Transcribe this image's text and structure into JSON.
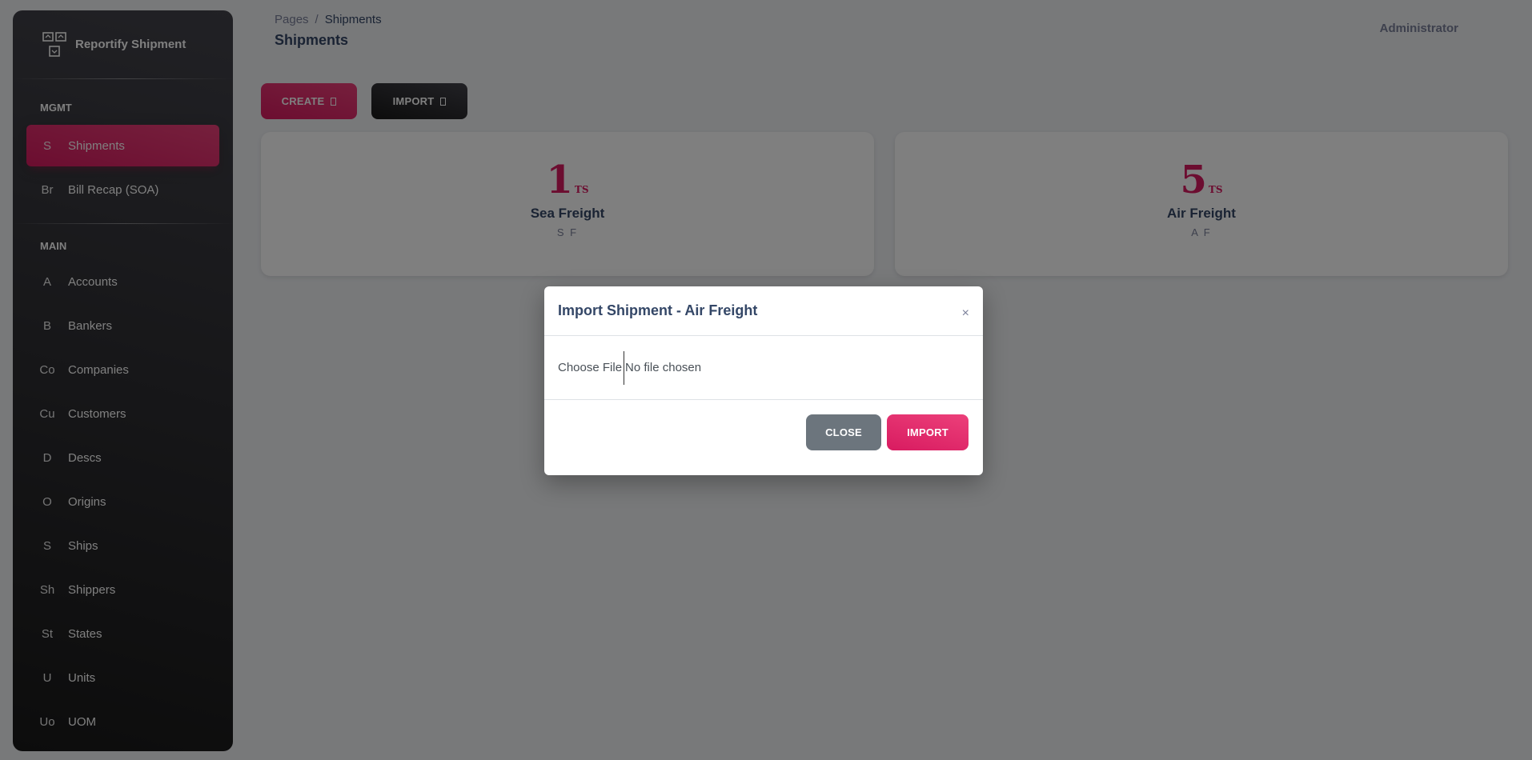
{
  "brand": {
    "name": "Reportify Shipment",
    "logo_icon": "boxes-logo-icon"
  },
  "sidebar": {
    "sections": [
      {
        "title": "MGMT",
        "items": [
          {
            "abbr": "S",
            "label": "Shipments",
            "active": true
          },
          {
            "abbr": "Br",
            "label": "Bill Recap (SOA)",
            "active": false
          }
        ]
      },
      {
        "title": "MAIN",
        "items": [
          {
            "abbr": "A",
            "label": "Accounts"
          },
          {
            "abbr": "B",
            "label": "Bankers"
          },
          {
            "abbr": "Co",
            "label": "Companies"
          },
          {
            "abbr": "Cu",
            "label": "Customers"
          },
          {
            "abbr": "D",
            "label": "Descs"
          },
          {
            "abbr": "O",
            "label": "Origins"
          },
          {
            "abbr": "S",
            "label": "Ships"
          },
          {
            "abbr": "Sh",
            "label": "Shippers"
          },
          {
            "abbr": "St",
            "label": "States"
          },
          {
            "abbr": "U",
            "label": "Units"
          },
          {
            "abbr": "Uo",
            "label": "UOM"
          }
        ]
      }
    ]
  },
  "header": {
    "breadcrumb_root": "Pages",
    "breadcrumb_sep": "/",
    "breadcrumb_current": "Shipments",
    "page_title": "Shipments",
    "user": "Administrator"
  },
  "toolbar": {
    "create_label": "CREATE",
    "import_label": "IMPORT"
  },
  "cards": {
    "sea": {
      "count": "1",
      "unit": "TS",
      "title": "Sea Freight",
      "sub": "S F"
    },
    "air": {
      "count": "5",
      "unit": "TS",
      "title": "Air Freight",
      "sub": "A F"
    }
  },
  "modal": {
    "title": "Import Shipment - Air Freight",
    "close_x": "×",
    "file_button": "Choose File",
    "file_status": "No file chosen",
    "close_label": "CLOSE",
    "import_label": "IMPORT"
  },
  "colors": {
    "accent": "#d81b60",
    "sidebar_dark": "#191919",
    "text": "#344767",
    "muted": "#7b809a"
  }
}
